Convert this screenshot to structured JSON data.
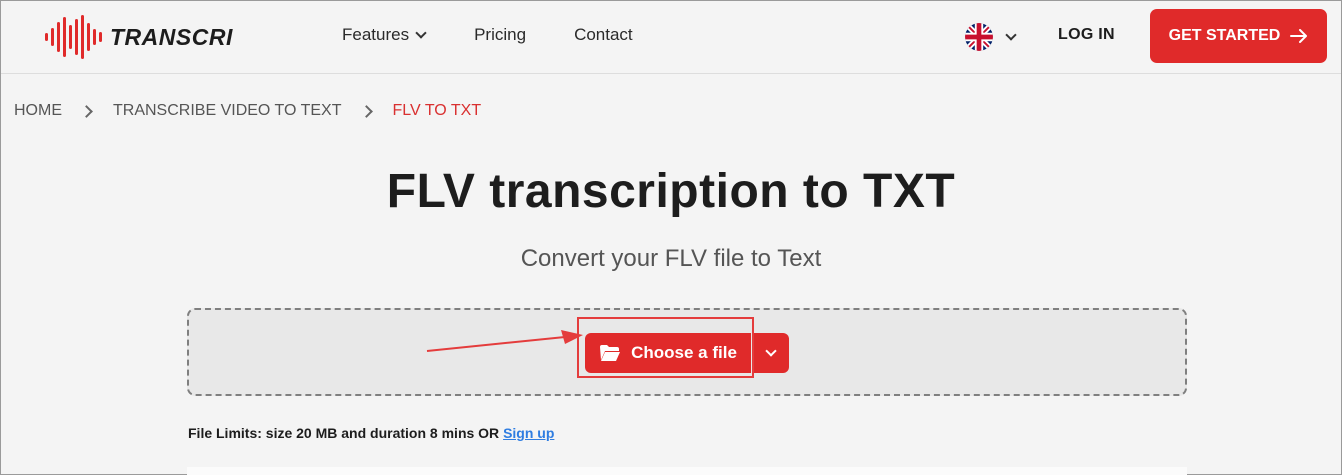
{
  "header": {
    "logo_text": "TRANSCRI",
    "nav": [
      {
        "label": "Features",
        "has_dropdown": true
      },
      {
        "label": "Pricing"
      },
      {
        "label": "Contact"
      }
    ],
    "language_icon": "uk-flag-icon",
    "login_label": "LOG IN",
    "get_started_label": "GET STARTED"
  },
  "breadcrumb": {
    "items": [
      "HOME",
      "TRANSCRIBE VIDEO TO TEXT",
      "FLV TO TXT"
    ]
  },
  "main": {
    "title": "FLV transcription to TXT",
    "subtitle": "Convert your FLV file to Text",
    "choose_file_label": "Choose a file",
    "limits_text": "File Limits: size 20 MB and duration 8 mins OR",
    "signup_label": "Sign up"
  },
  "colors": {
    "accent": "#e02a2a",
    "annotation": "#e43c3c",
    "link": "#2f7de1"
  }
}
